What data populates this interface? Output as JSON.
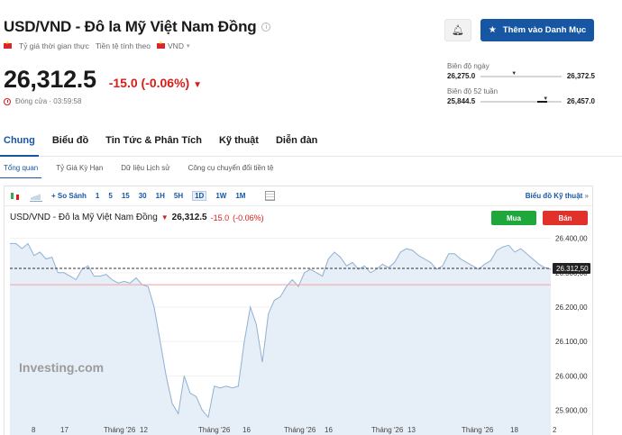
{
  "header": {
    "title": "USD/VND - Đô la Mỹ Việt Nam Đồng",
    "realtime_label": "Tỷ giá thời gian thực",
    "currency_label": "Tiền tệ tính theo",
    "currency_value": "VND",
    "price": "26,312.5",
    "change": "-15.0",
    "change_pct": "(-0.06%)",
    "closed_label": "Đóng cửa · 03:59:58"
  },
  "actions": {
    "watchlist_label": "Thêm vào Danh Mục"
  },
  "ranges": {
    "day_label": "Biên độ ngày",
    "day_low": "26,275.0",
    "day_high": "26,372.5",
    "day_position": 0.38,
    "week52_label": "Biên độ 52 tuần",
    "week52_low": "25,844.5",
    "week52_high": "26,457.0",
    "week52_position": 0.77
  },
  "tabs": [
    "Chung",
    "Biểu đồ",
    "Tin Tức & Phân Tích",
    "Kỹ thuật",
    "Diễn đàn"
  ],
  "subtabs": [
    "Tổng quan",
    "Tỷ Giá Kỳ Hạn",
    "Dữ liệu Lịch sử",
    "Công cụ chuyển đổi tiền tệ"
  ],
  "toolbar": {
    "compare_label": "So Sánh",
    "periods": [
      "1",
      "5",
      "15",
      "30",
      "1H",
      "5H",
      "1D",
      "1W",
      "1M"
    ],
    "active_period": "1D",
    "advanced_label": "Biểu đồ Kỹ thuật",
    "advanced_arrow": "»"
  },
  "chart_header": {
    "name": "USD/VND - Đô la Mỹ Việt Nam Đồng",
    "price": "26,312.5",
    "change": "-15.0",
    "change_pct": "(-0.06%)",
    "buy_label": "Mua",
    "sell_label": "Bán"
  },
  "chart_data": {
    "type": "area",
    "y_ticks": [
      "26.400,00",
      "26.300,00",
      "26.200,00",
      "26.100,00",
      "26.000,00",
      "25.900,00"
    ],
    "ylim": [
      25870,
      26420
    ],
    "current_label": "26.312,50",
    "current_value": 26312.5,
    "reference_value": 26265,
    "x_ticks": [
      "8",
      "17",
      "Tháng '26",
      "12",
      "Tháng '26",
      "16",
      "Tháng '26",
      "16",
      "Tháng '26",
      "13",
      "Tháng '26",
      "18",
      "2"
    ],
    "watermark": "Investing.com",
    "values": [
      26385,
      26385,
      26370,
      26385,
      26350,
      26360,
      26340,
      26345,
      26300,
      26300,
      26290,
      26280,
      26310,
      26320,
      26290,
      26290,
      26295,
      26280,
      26270,
      26275,
      26270,
      26285,
      26265,
      26260,
      26200,
      26100,
      26000,
      25920,
      25890,
      26000,
      25950,
      25940,
      25900,
      25880,
      25970,
      25965,
      25970,
      25965,
      25970,
      26100,
      26200,
      26150,
      26040,
      26180,
      26220,
      26230,
      26260,
      26280,
      26260,
      26300,
      26310,
      26300,
      26290,
      26340,
      26360,
      26345,
      26320,
      26330,
      26310,
      26320,
      26300,
      26310,
      26325,
      26315,
      26330,
      26360,
      26370,
      26365,
      26350,
      26340,
      26330,
      26310,
      26320,
      26355,
      26355,
      26340,
      26330,
      26320,
      26310,
      26325,
      26335,
      26365,
      26375,
      26380,
      26360,
      26370,
      26355,
      26340,
      26325,
      26315,
      26310
    ]
  }
}
